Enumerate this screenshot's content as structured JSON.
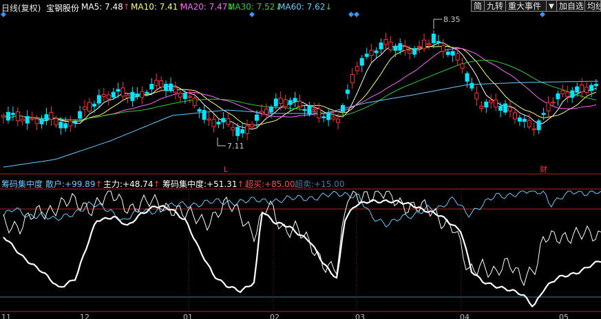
{
  "header": {
    "period": "日线(复权)",
    "stock": "宝钢股份",
    "ma": [
      {
        "label": "MA5: 7.48",
        "arrow": "↑",
        "color": "#ffffff",
        "arrow_color": "#ff3333"
      },
      {
        "label": "MA10: 7.41",
        "arrow": "↑",
        "color": "#ffff66",
        "arrow_color": "#ff3333"
      },
      {
        "label": "MA20: 7.47",
        "arrow": "↓",
        "color": "#ff66ff",
        "arrow_color": "#33cc33"
      },
      {
        "label": "MA30: 7.52",
        "arrow": "↓",
        "color": "#33cc33",
        "arrow_color": "#33cc33"
      },
      {
        "label": "MA60: 7.62",
        "arrow": "↓",
        "color": "#66ccff",
        "arrow_color": "#33cc33"
      }
    ]
  },
  "toolbar": {
    "buttons": [
      "简",
      "九转",
      "重大事件"
    ],
    "dropdown": "▼",
    "add": "加自选",
    "cut": "均线"
  },
  "indicator": {
    "name": "筹码集中度",
    "items": [
      {
        "label": "散户:",
        "value": "+99.89",
        "arrow": "↑",
        "color": "#66ccff",
        "value_color": "#66ccff"
      },
      {
        "label": "主力:",
        "value": "+48.74",
        "arrow": "↑",
        "color": "#ffffff",
        "value_color": "#ffffff"
      },
      {
        "label": "筹码集中度:",
        "value": "+51.31",
        "arrow": "↑",
        "color": "#ffffff",
        "value_color": "#ffffff"
      },
      {
        "label": "超买:",
        "value": "+85.00",
        "arrow": "",
        "color": "#ff4d4d",
        "value_color": "#ff4d4d"
      },
      {
        "label": "超卖:",
        "value": "+15.00",
        "arrow": "",
        "color": "#3a7fa0",
        "value_color": "#3a7fa0"
      }
    ]
  },
  "colors": {
    "up": "#ff3333",
    "down": "#00e5ff",
    "grid": "#b22222",
    "retail": "#66ccff",
    "main": "#ffffff",
    "concentration": "#ffffff"
  },
  "chart_data": [
    {
      "type": "candlestick",
      "price_max_label": "8.35",
      "price_min_label": "7.11",
      "markers": [
        "L",
        "财"
      ],
      "x_ticks": [
        "11",
        "12",
        "01",
        "02",
        "03",
        "04",
        "05"
      ],
      "series_names": [
        "MA5",
        "MA10",
        "MA20",
        "MA30",
        "MA60"
      ]
    },
    {
      "type": "line",
      "title": "筹码集中度",
      "series": [
        {
          "name": "散户",
          "last_value": 99.89
        },
        {
          "name": "主力",
          "last_value": 48.74
        },
        {
          "name": "筹码集中度",
          "last_value": 51.31
        }
      ],
      "levels": [
        {
          "name": "超买",
          "value": 85
        },
        {
          "name": "超卖",
          "value": 15
        }
      ],
      "ylim": [
        0,
        100
      ]
    }
  ]
}
